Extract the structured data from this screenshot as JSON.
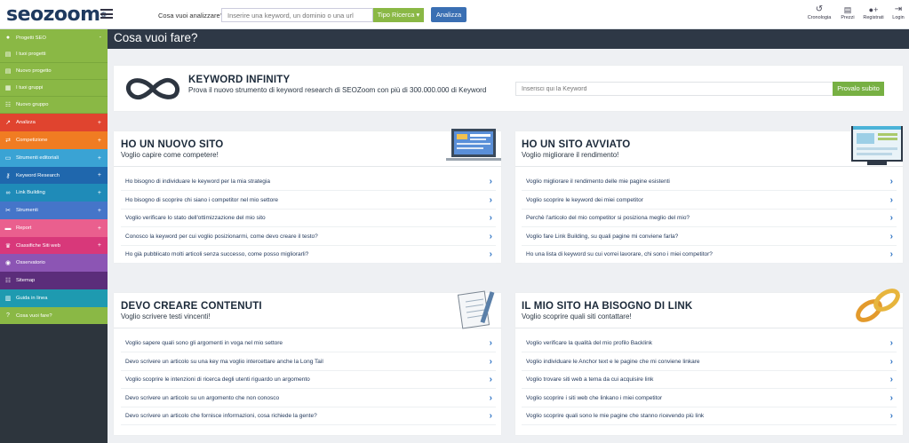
{
  "topbar": {
    "logo": "seozoom",
    "search_label": "Cosa vuoi analizzare?",
    "search_placeholder": "Inserire una keyword, un dominio o una url",
    "tipo_ricerca": "Tipo Ricerca ▾",
    "analizza": "Analizza",
    "nav": [
      {
        "label": "Cronologia",
        "icon": "history-icon",
        "glyph": "↺"
      },
      {
        "label": "Prezzi",
        "icon": "cart-icon",
        "glyph": "🛒"
      },
      {
        "label": "Registrati",
        "icon": "user-plus-icon",
        "glyph": "👤"
      },
      {
        "label": "Login",
        "icon": "login-icon",
        "glyph": "⇥"
      }
    ]
  },
  "sidebar": {
    "items": [
      {
        "label": "Progetti SEO",
        "color": "#8ab845",
        "icon": "globe-icon",
        "glyph": "●",
        "plus": "-"
      },
      {
        "label": "I tuoi progetti",
        "color": "#8ab845",
        "icon": "file-icon",
        "glyph": "▤",
        "plus": ""
      },
      {
        "label": "Nuovo progetto",
        "color": "#8ab845",
        "icon": "new-file-icon",
        "glyph": "▤",
        "plus": ""
      },
      {
        "label": "I tuoi gruppi",
        "color": "#8ab845",
        "icon": "group-icon",
        "glyph": "▦",
        "plus": ""
      },
      {
        "label": "Nuovo gruppo",
        "color": "#8ab845",
        "icon": "sitemap-icon",
        "glyph": "☷",
        "plus": ""
      },
      {
        "label": "Analizza",
        "color": "#e0442f",
        "icon": "chart-icon",
        "glyph": "↗",
        "plus": "+"
      },
      {
        "label": "Competizione",
        "color": "#f07c22",
        "icon": "compete-icon",
        "glyph": "⇄",
        "plus": "+"
      },
      {
        "label": "Strumenti editoriali",
        "color": "#3aa3d4",
        "icon": "edit-icon",
        "glyph": "▭",
        "plus": "+"
      },
      {
        "label": "Keyword Research",
        "color": "#1f67ad",
        "icon": "key-icon",
        "glyph": "⚷",
        "plus": "+"
      },
      {
        "label": "Link Building",
        "color": "#1f8bb8",
        "icon": "link-icon",
        "glyph": "∞",
        "plus": "+"
      },
      {
        "label": "Strumenti",
        "color": "#4575c9",
        "icon": "tools-icon",
        "glyph": "✂",
        "plus": "+"
      },
      {
        "label": "Report",
        "color": "#ea5f8e",
        "icon": "report-icon",
        "glyph": "▬",
        "plus": "+"
      },
      {
        "label": "Classifiche Siti web",
        "color": "#d8387a",
        "icon": "trophy-icon",
        "glyph": "♛",
        "plus": "+"
      },
      {
        "label": "Osservatorio",
        "color": "#8c55b4",
        "icon": "eye-icon",
        "glyph": "◉",
        "plus": ""
      },
      {
        "label": "Sitemap",
        "color": "#5b2d7a",
        "icon": "sitemap-icon",
        "glyph": "☷",
        "plus": ""
      },
      {
        "label": "Guida in linea",
        "color": "#1e9ab0",
        "icon": "book-icon",
        "glyph": "▥",
        "plus": ""
      },
      {
        "label": "Cosa vuoi fare?",
        "color": "#8ab845",
        "icon": "question-icon",
        "glyph": "?",
        "plus": ""
      }
    ]
  },
  "page_title": "Cosa vuoi fare?",
  "keyword_infinity": {
    "title": "KEYWORD INFINITY",
    "subtitle": "Prova il nuovo strumento di keyword research di SEOZoom con più di 300.000.000 di Keyword",
    "placeholder": "Inserisci qui la Keyword",
    "button": "Provalo subito"
  },
  "sections": [
    {
      "title": "HO UN NUOVO SITO",
      "subtitle": "Voglio capire come competere!",
      "links": [
        "Ho bisogno di individuare le keyword per la mia strategia",
        "Ho bisogno di scoprire chi siano i competitor nel mio settore",
        "Voglio verificare lo stato dell'ottimizzazione del mio sito",
        "Conosco la keyword per cui voglio posizionarmi, come devo creare il testo?",
        "Ho già pubblicato molti articoli senza successo, come posso migliorarli?"
      ]
    },
    {
      "title": "HO UN SITO AVVIATO",
      "subtitle": "Voglio migliorare il rendimento!",
      "links": [
        "Voglio migliorare il rendimento delle mie pagine esistenti",
        "Voglio scoprire le keyword dei miei competitor",
        "Perchè l'articolo del mio competitor si posiziona meglio del mio?",
        "Voglio fare Link Building, su quali pagine mi conviene farla?",
        "Ho una lista di keyword su cui vorrei lavorare, chi sono i miei competitor?"
      ]
    },
    {
      "title": "DEVO CREARE CONTENUTI",
      "subtitle": "Voglio scrivere testi vincenti!",
      "links": [
        "Voglio sapere quali sono gli argomenti in voga nel mio settore",
        "Devo scrivere un articolo su una key ma voglio intercettare anche la Long Tail",
        "Voglio scoprire le intenzioni di ricerca degli utenti riguardo un argomento",
        "Devo scrivere un articolo su un argomento che non conosco",
        "Devo scrivere un articolo che fornisce informazioni, cosa richiede la gente?"
      ]
    },
    {
      "title": "IL MIO SITO HA BISOGNO DI LINK",
      "subtitle": "Voglio scoprire quali siti contattare!",
      "links": [
        "Voglio verificare la qualità del mio profilo Backlink",
        "Voglio individuare le Anchor text e le pagine che mi conviene linkare",
        "Voglio trovare siti web a tema da cui acquisire link",
        "Voglio scoprire i siti web che linkano i miei competitor",
        "Voglio scoprire quali sono le mie pagine che stanno ricevendo più link"
      ]
    }
  ]
}
